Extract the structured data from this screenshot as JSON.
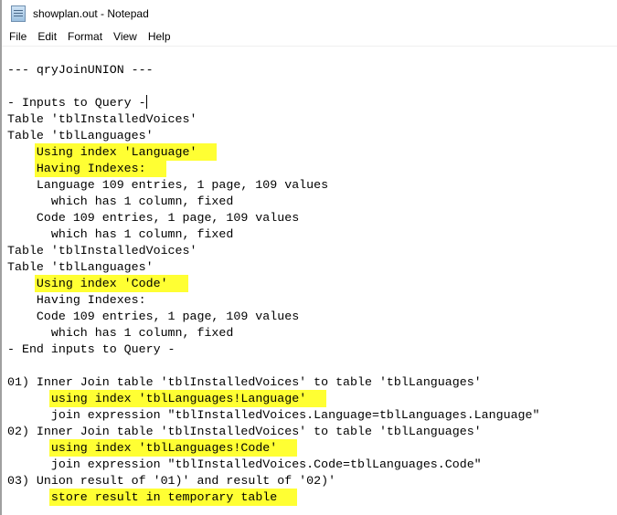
{
  "window": {
    "title": "showplan.out - Notepad",
    "icon": "notepad-icon"
  },
  "menu": [
    "File",
    "Edit",
    "Format",
    "View",
    "Help"
  ],
  "lines": [
    {
      "text": "--- qryJoinUNION ---",
      "hl": false
    },
    {
      "text": "",
      "hl": false
    },
    {
      "text": "- Inputs to Query -",
      "hl": false,
      "caret": true
    },
    {
      "text": "Table 'tblInstalledVoices'",
      "hl": false
    },
    {
      "text": "Table 'tblLanguages'",
      "hl": false
    },
    {
      "text": "    Using index 'Language'",
      "hl": true
    },
    {
      "text": "    Having Indexes:",
      "hl": true
    },
    {
      "text": "    Language 109 entries, 1 page, 109 values",
      "hl": false
    },
    {
      "text": "      which has 1 column, fixed",
      "hl": false
    },
    {
      "text": "    Code 109 entries, 1 page, 109 values",
      "hl": false
    },
    {
      "text": "      which has 1 column, fixed",
      "hl": false
    },
    {
      "text": "Table 'tblInstalledVoices'",
      "hl": false
    },
    {
      "text": "Table 'tblLanguages'",
      "hl": false
    },
    {
      "text": "    Using index 'Code'",
      "hl": true
    },
    {
      "text": "    Having Indexes:",
      "hl": false
    },
    {
      "text": "    Code 109 entries, 1 page, 109 values",
      "hl": false
    },
    {
      "text": "      which has 1 column, fixed",
      "hl": false
    },
    {
      "text": "- End inputs to Query -",
      "hl": false
    },
    {
      "text": "",
      "hl": false
    },
    {
      "text": "01) Inner Join table 'tblInstalledVoices' to table 'tblLanguages'",
      "hl": false
    },
    {
      "text": "      using index 'tblLanguages!Language'",
      "hl": true
    },
    {
      "text": "      join expression \"tblInstalledVoices.Language=tblLanguages.Language\"",
      "hl": false
    },
    {
      "text": "02) Inner Join table 'tblInstalledVoices' to table 'tblLanguages'",
      "hl": false
    },
    {
      "text": "      using index 'tblLanguages!Code'",
      "hl": true
    },
    {
      "text": "      join expression \"tblInstalledVoices.Code=tblLanguages.Code\"",
      "hl": false
    },
    {
      "text": "03) Union result of '01)' and result of '02)'",
      "hl": false
    },
    {
      "text": "      store result in temporary table",
      "hl": true
    }
  ],
  "highlight_color": "#ffff33"
}
